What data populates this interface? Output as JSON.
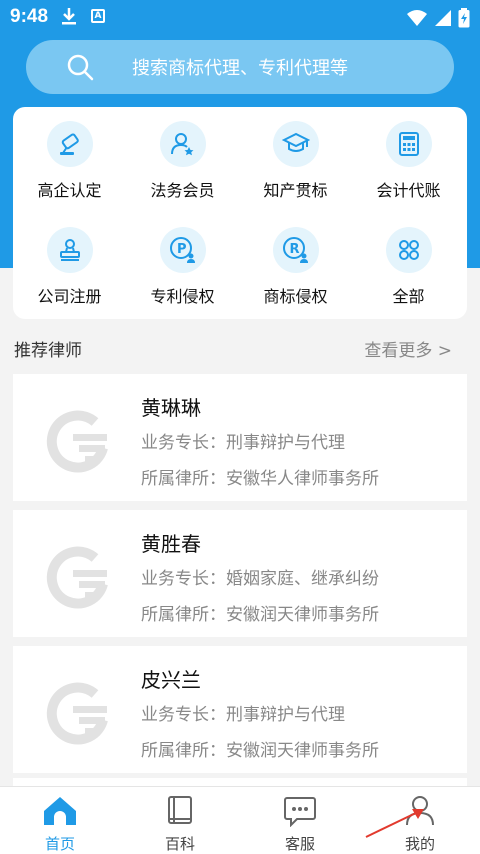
{
  "status": {
    "time": "9:48"
  },
  "search": {
    "placeholder": "搜索商标代理、专利代理等"
  },
  "services": [
    {
      "label": "高企认定",
      "icon": "certificate-icon"
    },
    {
      "label": "法务会员",
      "icon": "member-star-icon"
    },
    {
      "label": "知产贯标",
      "icon": "graduation-cap-icon"
    },
    {
      "label": "会计代账",
      "icon": "calculator-icon"
    },
    {
      "label": "公司注册",
      "icon": "stamp-icon"
    },
    {
      "label": "专利侵权",
      "icon": "patent-icon"
    },
    {
      "label": "商标侵权",
      "icon": "trademark-icon"
    },
    {
      "label": "全部",
      "icon": "grid-all-icon"
    }
  ],
  "recommend": {
    "title": "推荐律师",
    "more": "查看更多 >"
  },
  "lawyers": [
    {
      "name": "黄琳琳",
      "specialty": "业务专长：刑事辩护与代理",
      "firm": "所属律所：安徽华人律师事务所"
    },
    {
      "name": "黄胜春",
      "specialty": "业务专长：婚姻家庭、继承纠纷",
      "firm": "所属律所：安徽润天律师事务所"
    },
    {
      "name": "皮兴兰",
      "specialty": "业务专长：刑事辩护与代理",
      "firm": "所属律所：安徽润天律师事务所"
    }
  ],
  "tabs": [
    {
      "label": "首页"
    },
    {
      "label": "百科"
    },
    {
      "label": "客服"
    },
    {
      "label": "我的"
    }
  ],
  "colors": {
    "primary": "#1f9ae6",
    "icon_bg": "#e4f4fc"
  }
}
